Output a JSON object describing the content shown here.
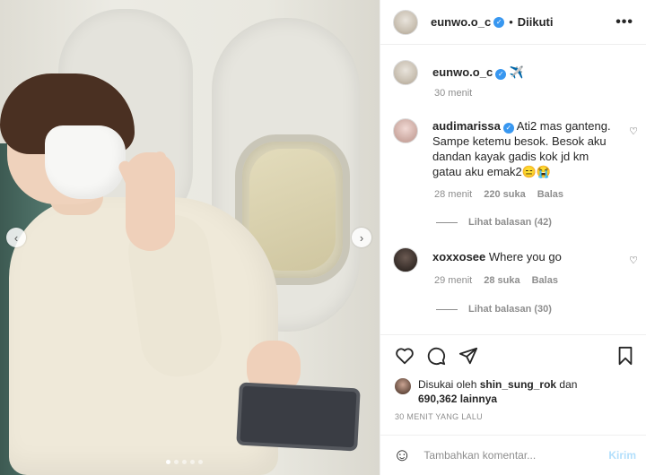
{
  "post": {
    "author": "eunwo.o_c",
    "follow_sep": "•",
    "follow_label": "Diikuti",
    "more_label": "•••",
    "caption_emoji": "✈️",
    "caption_time": "30 menit"
  },
  "comments": [
    {
      "user": "audimarissa",
      "text": "Ati2 mas ganteng. Sampe ketemu besok. Besok aku dandan kayak gadis kok jd km gatau aku emak2😑😭",
      "time": "28 menit",
      "likes": "220 suka",
      "reply_label": "Balas",
      "view_replies": "Lihat balasan (42)"
    },
    {
      "user": "xoxxosee",
      "text": "Where you go",
      "time": "29 menit",
      "likes": "28 suka",
      "reply_label": "Balas",
      "view_replies": "Lihat balasan (30)"
    }
  ],
  "likes": {
    "prefix": "Disukai oleh",
    "user": "shin_sung_rok",
    "connector": "dan",
    "count_text": "690,362 lainnya"
  },
  "timestamp": "30 MENIT YANG LALU",
  "add_comment": {
    "placeholder": "Tambahkan komentar...",
    "post_label": "Kirim"
  },
  "icons": {
    "nav_prev": "‹",
    "nav_next": "›",
    "verified": "✓",
    "heart": "♡",
    "emoji": "☺"
  },
  "colors": {
    "verified": "#3897f0",
    "post_disabled": "#b2dffc",
    "muted": "#8e8e8e"
  },
  "carousel": {
    "dot_count": 5,
    "active_index": 0
  }
}
